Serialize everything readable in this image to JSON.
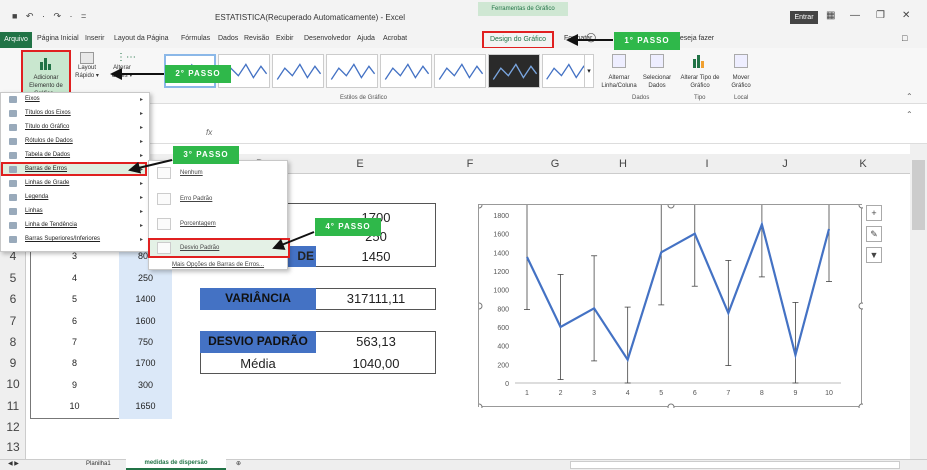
{
  "window": {
    "title": "ESTATISTICA(Recuperado Automaticamente) - Excel",
    "quick_access": "■ ↶ · ↷ · =",
    "context_tab_group": "Ferramentas de Gráfico",
    "signin": "Entrar",
    "minimize": "—",
    "restore": "❐",
    "close": "✕"
  },
  "tabs": {
    "arquivo": "Arquivo",
    "items": [
      "Página Inicial",
      "Inserir",
      "Layout da Página",
      "Fórmulas",
      "Dados",
      "Revisão",
      "Exibir",
      "Desenvolvedor",
      "Ajuda",
      "Acrobat"
    ],
    "design": "Design do Gráfico",
    "formatar": "Formatar",
    "tell_me": "deseja fazer"
  },
  "ribbon": {
    "adicionar": "Adicionar Elemento de Gráfico ▾",
    "layout": "Layout Rápido ▾",
    "alterar_cores": "Alterar Cores ▾",
    "gallery_label": "Estilos de Gráfico",
    "alternar": "Alternar Linha/Coluna",
    "selecionar": "Selecionar Dados",
    "alterar_tipo": "Alterar Tipo de Gráfico",
    "mover": "Mover Gráfico",
    "group_dados": "Dados",
    "group_tipo": "Tipo",
    "group_local": "Local"
  },
  "menu": {
    "items": [
      "Eixos",
      "Títulos dos Eixos",
      "Título do Gráfico",
      "Rótulos de Dados",
      "Tabela de Dados",
      "Barras de Erros",
      "Linhas de Grade",
      "Legenda",
      "Linhas",
      "Linha de Tendência",
      "Barras Superiores/Inferiores"
    ]
  },
  "submenu": {
    "items": [
      "Nenhum",
      "Erro Padrão",
      "Porcentagem",
      "Desvio Padrão"
    ],
    "more": "Mais Opções de Barras de Erros..."
  },
  "annotations": {
    "passo1": "1° PASSO",
    "passo2": "2° PASSO",
    "passo3": "3° PASSO",
    "passo4": "4° PASSO"
  },
  "formula": {
    "fx": "fx"
  },
  "sheet": {
    "columns": [
      "D",
      "E",
      "F",
      "G",
      "H",
      "I",
      "J",
      "K"
    ],
    "rows": [
      "4",
      "5",
      "6",
      "7",
      "8",
      "9",
      "10",
      "11",
      "12",
      "13"
    ],
    "col_a": [
      "3",
      "4",
      "5",
      "6",
      "7",
      "8",
      "9",
      "10"
    ],
    "col_b": [
      "800",
      "250",
      "1400",
      "1600",
      "750",
      "1700",
      "300",
      "1650"
    ],
    "e_values_top": [
      "1700",
      "250"
    ],
    "stat_label_partial": "DE",
    "stat_value_partial": "1450",
    "variancia_label": "VARIÂNCIA",
    "variancia_value": "317111,11",
    "desvio_label": "DESVIO PADRÃO",
    "desvio_value": "563,13",
    "media_label": "Média",
    "media_value": "1040,00"
  },
  "chart_data": {
    "type": "line",
    "x": [
      1,
      2,
      3,
      4,
      5,
      6,
      7,
      8,
      9,
      10
    ],
    "series": [
      {
        "values": [
          1350,
          600,
          800,
          250,
          1400,
          1600,
          750,
          1700,
          300,
          1650
        ],
        "color": "#4472c4"
      }
    ],
    "ylim": [
      0,
      1800
    ],
    "yticks": [
      0,
      200,
      400,
      600,
      800,
      1000,
      1200,
      1400,
      1600,
      1800
    ],
    "error_bar": 563.13,
    "grid": false
  },
  "chart_buttons": [
    "+",
    "✎",
    "▼"
  ],
  "status": {
    "sheet1": "Planilha1",
    "sheet2": "medidas de dispersão",
    "add": "⊕"
  },
  "colors": {
    "excel_green": "#217346",
    "highlight_red": "#e02020",
    "passo_green": "#2fb84a",
    "stat_blue": "#4472c4"
  }
}
